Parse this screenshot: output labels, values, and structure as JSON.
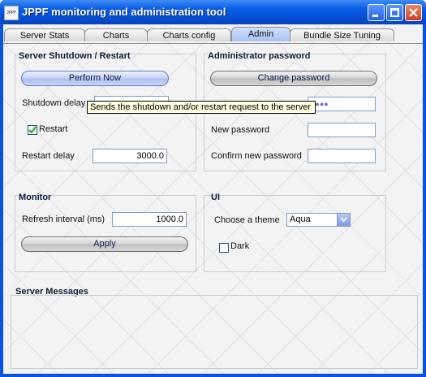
{
  "window": {
    "title": "JPPF monitoring and administration tool",
    "icon_text": "JPPF",
    "controls": [
      "minimize-icon",
      "maximize-icon",
      "close-icon"
    ]
  },
  "tabs": [
    {
      "label": "Server Stats",
      "active": false
    },
    {
      "label": "Charts",
      "active": false
    },
    {
      "label": "Charts config",
      "active": false
    },
    {
      "label": "Admin",
      "active": true
    },
    {
      "label": "Bundle Size Tuning",
      "active": false
    }
  ],
  "shutdown": {
    "title": "Server Shutdown / Restart",
    "perform_label": "Perform Now",
    "shutdown_delay_label": "Shutdown delay",
    "restart_label": "Restart",
    "restart_checked": true,
    "restart_delay_label": "Restart delay",
    "restart_delay_value": "3000.0"
  },
  "tooltip": "Sends the shutdown and/or restart request to the server",
  "admin_password": {
    "title": "Administrator password",
    "change_label": "Change password",
    "current_masked": "●●●●",
    "new_label": "New password",
    "confirm_label": "Confirm new password"
  },
  "monitor": {
    "title": "Monitor",
    "refresh_label": "Refresh interval (ms)",
    "refresh_value": "1000.0",
    "apply_label": "Apply"
  },
  "ui": {
    "title": "UI",
    "theme_label": "Choose a theme",
    "theme_value": "Aqua",
    "dark_label": "Dark",
    "dark_checked": false
  },
  "messages": {
    "title": "Server Messages"
  }
}
